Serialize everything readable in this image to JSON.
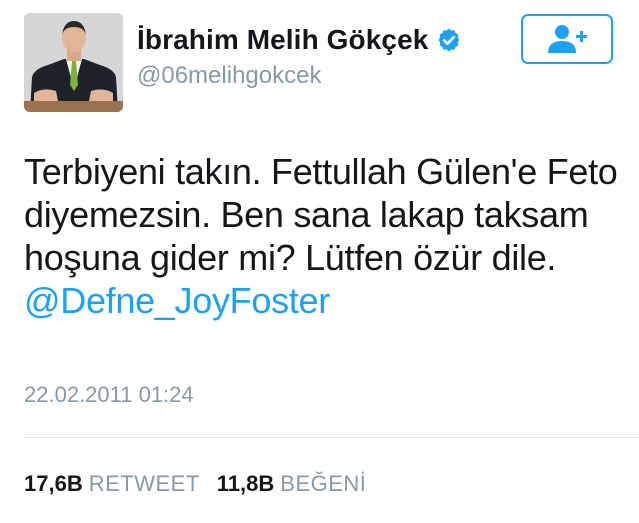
{
  "profile": {
    "display_name": "İbrahim Melih Gökçek",
    "handle": "@06melihgokcek",
    "verified": true
  },
  "tweet": {
    "text": "Terbiyeni takın. Fettullah Gülen'e Feto diyemezsin. Ben sana lakap taksam hoşuna gider mi? Lütfen özür dile.",
    "mention": "@Defne_JoyFoster",
    "timestamp": "22.02.2011 01:24"
  },
  "stats": {
    "retweets_count": "17,6B",
    "retweets_label": "RETWEET",
    "likes_count": "11,8B",
    "likes_label": "BEĞENİ"
  },
  "icons": {
    "verified": "verified-badge-icon",
    "follow": "add-user-icon"
  },
  "colors": {
    "accent": "#1da1f2",
    "muted": "#8899a6",
    "text": "#14171a"
  }
}
